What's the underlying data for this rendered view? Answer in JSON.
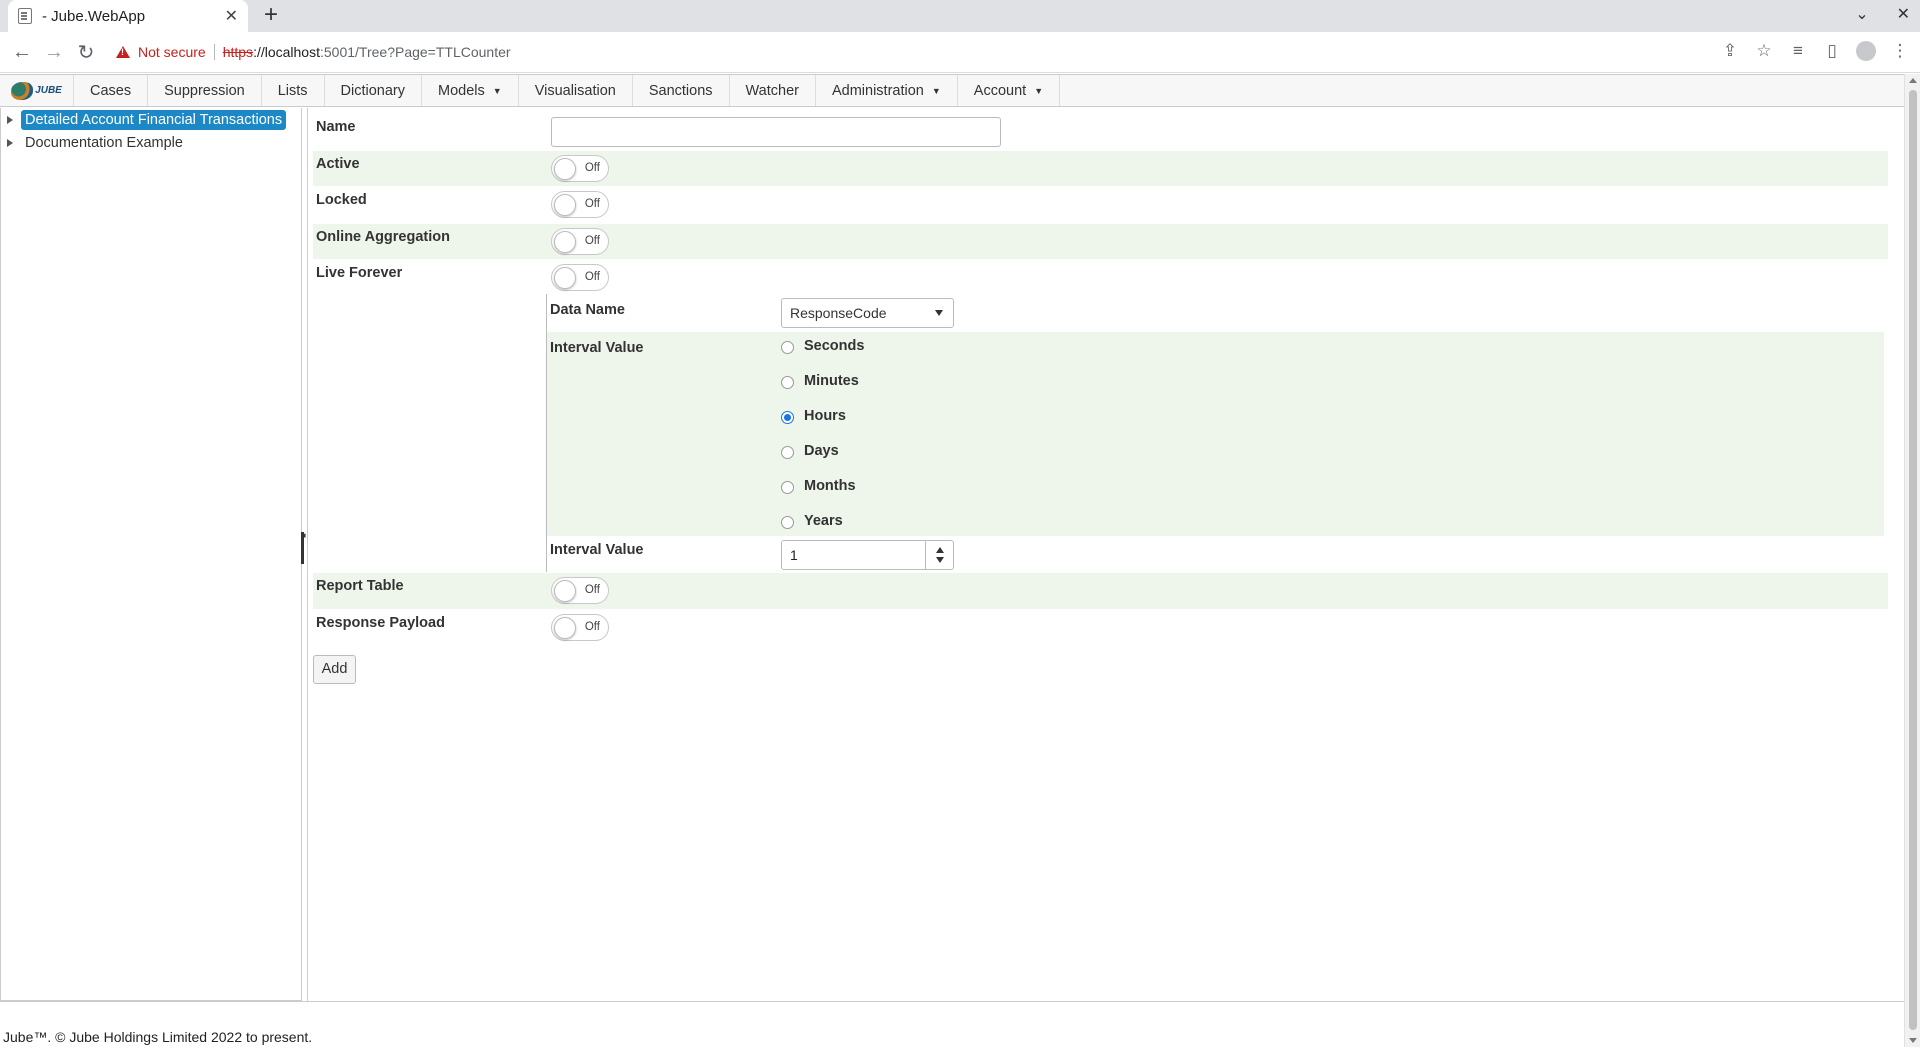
{
  "browser": {
    "tab_title": "- Jube.WebApp",
    "tab_close": "✕",
    "new_tab": "+",
    "security_label": "Not secure",
    "url_scheme": "https",
    "url_host": "://localhost",
    "url_rest": ":5001/Tree?Page=TTLCounter"
  },
  "nav": {
    "logo_text": "JUBE",
    "items": [
      {
        "label": "Cases"
      },
      {
        "label": "Suppression"
      },
      {
        "label": "Lists"
      },
      {
        "label": "Dictionary"
      },
      {
        "label": "Models",
        "caret": "▼"
      },
      {
        "label": "Visualisation"
      },
      {
        "label": "Sanctions"
      },
      {
        "label": "Watcher"
      },
      {
        "label": "Administration",
        "caret": "▼"
      },
      {
        "label": "Account",
        "caret": "▼"
      }
    ]
  },
  "tree": {
    "nodes": [
      {
        "label": "Detailed Account Financial Transactions",
        "selected": true
      },
      {
        "label": "Documentation Example",
        "selected": false
      }
    ]
  },
  "form": {
    "name_label": "Name",
    "name_value": "",
    "active_label": "Active",
    "locked_label": "Locked",
    "online_aggregation_label": "Online Aggregation",
    "live_forever_label": "Live Forever",
    "toggle_off": "Off",
    "data_name_label": "Data Name",
    "data_name_value": "ResponseCode",
    "interval_type_label": "Interval Value",
    "interval_options": [
      {
        "label": "Seconds",
        "checked": false
      },
      {
        "label": "Minutes",
        "checked": false
      },
      {
        "label": "Hours",
        "checked": true
      },
      {
        "label": "Days",
        "checked": false
      },
      {
        "label": "Months",
        "checked": false
      },
      {
        "label": "Years",
        "checked": false
      }
    ],
    "interval_value_label": "Interval Value",
    "interval_value": "1",
    "report_table_label": "Report Table",
    "response_payload_label": "Response Payload",
    "add_button": "Add"
  },
  "footer": {
    "text": "Jube™. © Jube Holdings Limited 2022 to present."
  },
  "colors": {
    "accent": "#1c89c6",
    "shade": "#eef6ec",
    "radio_checked": "#1a73e8",
    "warning": "#c5221f"
  }
}
